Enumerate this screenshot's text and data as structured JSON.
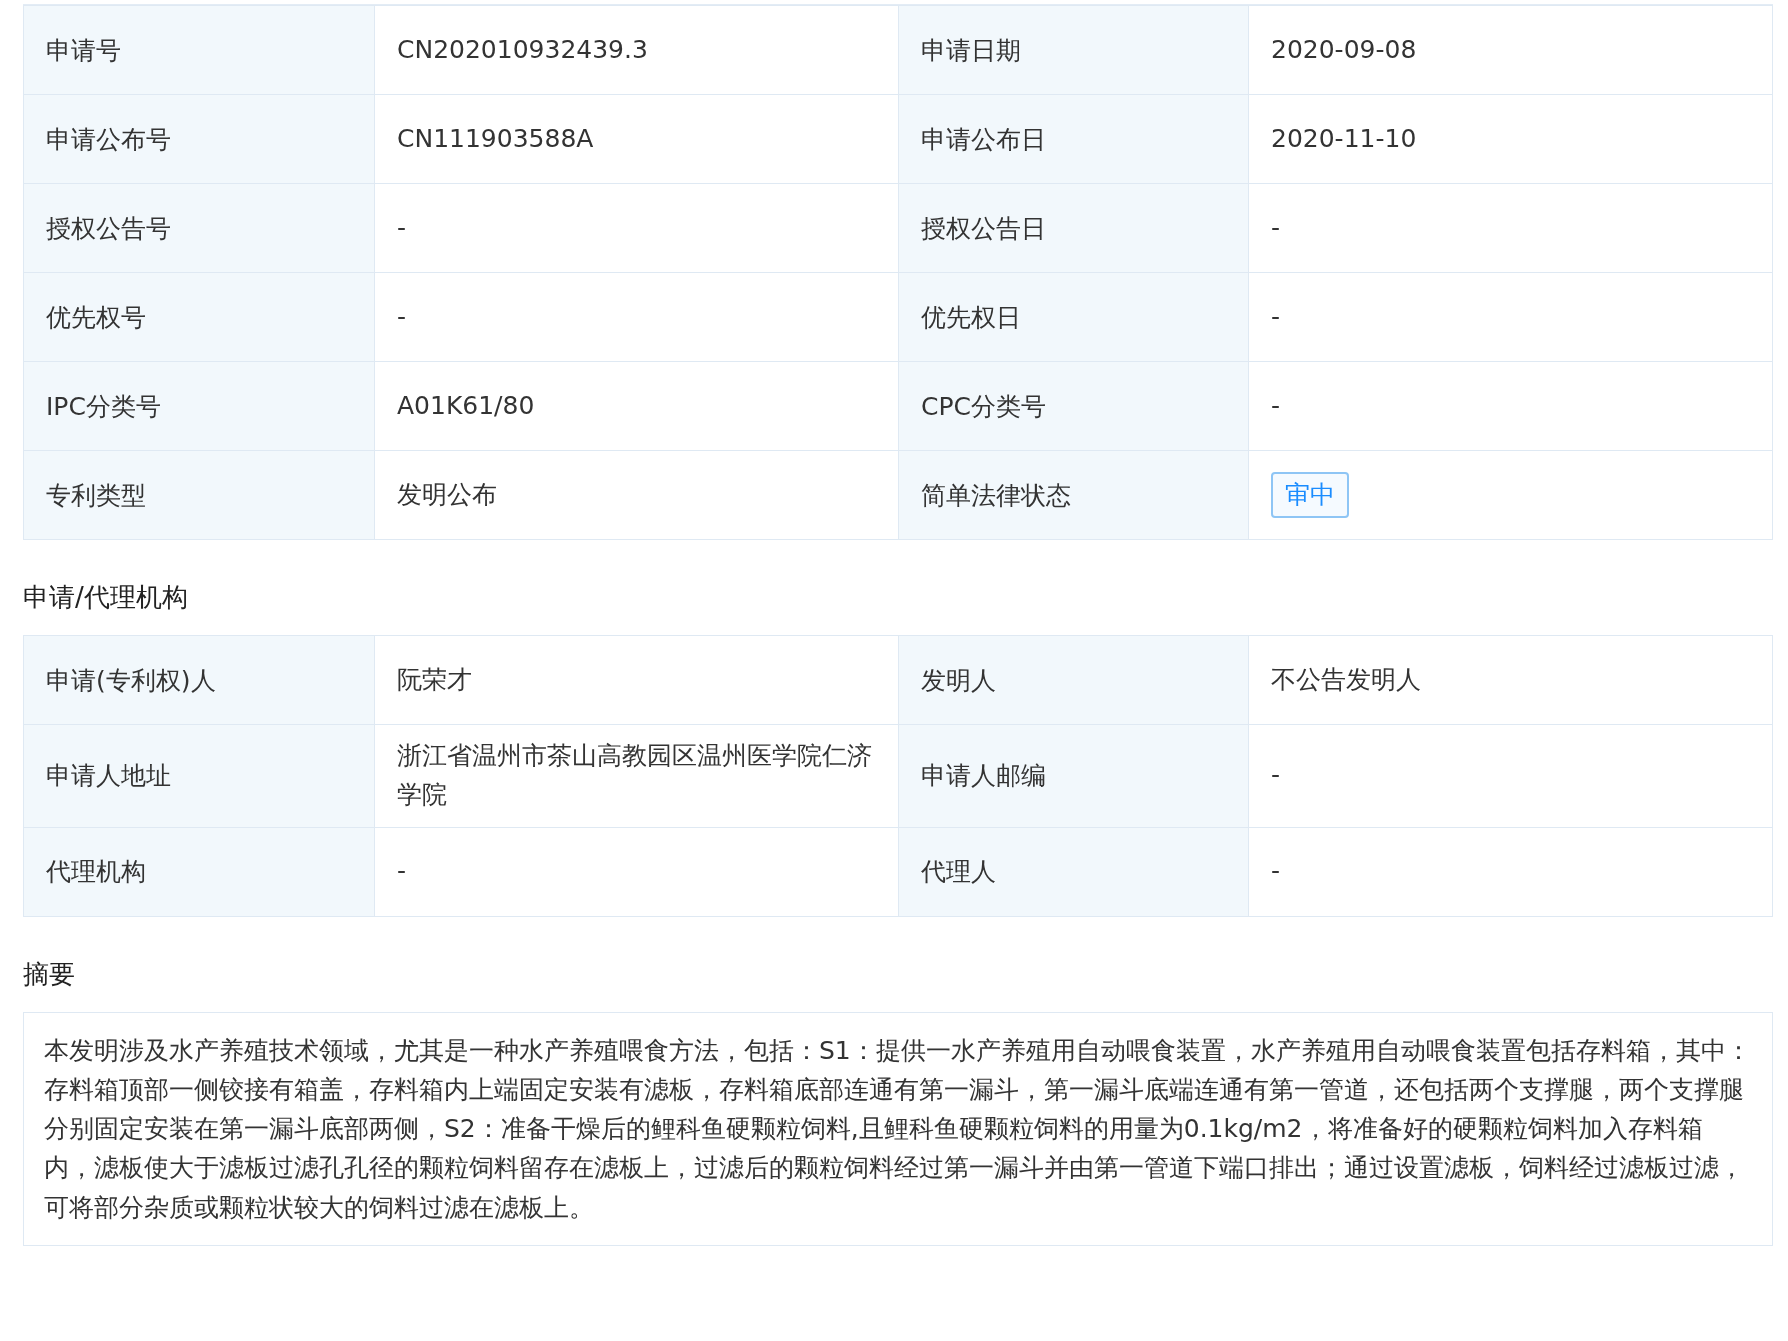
{
  "basic_table": {
    "rows": [
      {
        "cells": [
          {
            "label": "申请号",
            "value": "CN202010932439.3",
            "kind": "text"
          },
          {
            "label": "申请日期",
            "value": "2020-09-08",
            "kind": "text"
          }
        ]
      },
      {
        "cells": [
          {
            "label": "申请公布号",
            "value": "CN111903588A",
            "kind": "text"
          },
          {
            "label": "申请公布日",
            "value": "2020-11-10",
            "kind": "text"
          }
        ]
      },
      {
        "cells": [
          {
            "label": "授权公告号",
            "value": "-",
            "kind": "text"
          },
          {
            "label": "授权公告日",
            "value": "-",
            "kind": "text"
          }
        ]
      },
      {
        "cells": [
          {
            "label": "优先权号",
            "value": "-",
            "kind": "text"
          },
          {
            "label": "优先权日",
            "value": "-",
            "kind": "text"
          }
        ]
      },
      {
        "cells": [
          {
            "label": "IPC分类号",
            "value": "A01K61/80",
            "kind": "text"
          },
          {
            "label": "CPC分类号",
            "value": "-",
            "kind": "text"
          }
        ]
      },
      {
        "cells": [
          {
            "label": "专利类型",
            "value": "发明公布",
            "kind": "text"
          },
          {
            "label": "简单法律状态",
            "value": "审中",
            "kind": "tag"
          }
        ]
      }
    ]
  },
  "agency_section": {
    "title": "申请/代理机构",
    "rows": [
      {
        "cells": [
          {
            "label": "申请(专利权)人",
            "value": "阮荣才",
            "kind": "text"
          },
          {
            "label": "发明人",
            "value": "不公告发明人",
            "kind": "text"
          }
        ]
      },
      {
        "cells": [
          {
            "label": "申请人地址",
            "value": "浙江省温州市茶山高教园区温州医学院仁济学院",
            "kind": "text"
          },
          {
            "label": "申请人邮编",
            "value": "-",
            "kind": "text"
          }
        ]
      },
      {
        "cells": [
          {
            "label": "代理机构",
            "value": "-",
            "kind": "text"
          },
          {
            "label": "代理人",
            "value": "-",
            "kind": "text"
          }
        ]
      }
    ]
  },
  "abstract_section": {
    "title": "摘要",
    "text": "本发明涉及水产养殖技术领域，尤其是一种水产养殖喂食方法，包括：S1：提供一水产养殖用自动喂食装置，水产养殖用自动喂食装置包括存料箱，其中：存料箱顶部一侧铰接有箱盖，存料箱内上端固定安装有滤板，存料箱底部连通有第一漏斗，第一漏斗底端连通有第一管道，还包括两个支撑腿，两个支撑腿分别固定安装在第一漏斗底部两侧，S2：准备干燥后的鲤科鱼硬颗粒饲料,且鲤科鱼硬颗粒饲料的用量为0.1kg/m2，将准备好的硬颗粒饲料加入存料箱内，滤板使大于滤板过滤孔孔径的颗粒饲料留存在滤板上，过滤后的颗粒饲料经过第一漏斗并由第一管道下端口排出；通过设置滤板，饲料经过滤板过滤，可将部分杂质或颗粒状较大的饲料过滤在滤板上。"
  }
}
